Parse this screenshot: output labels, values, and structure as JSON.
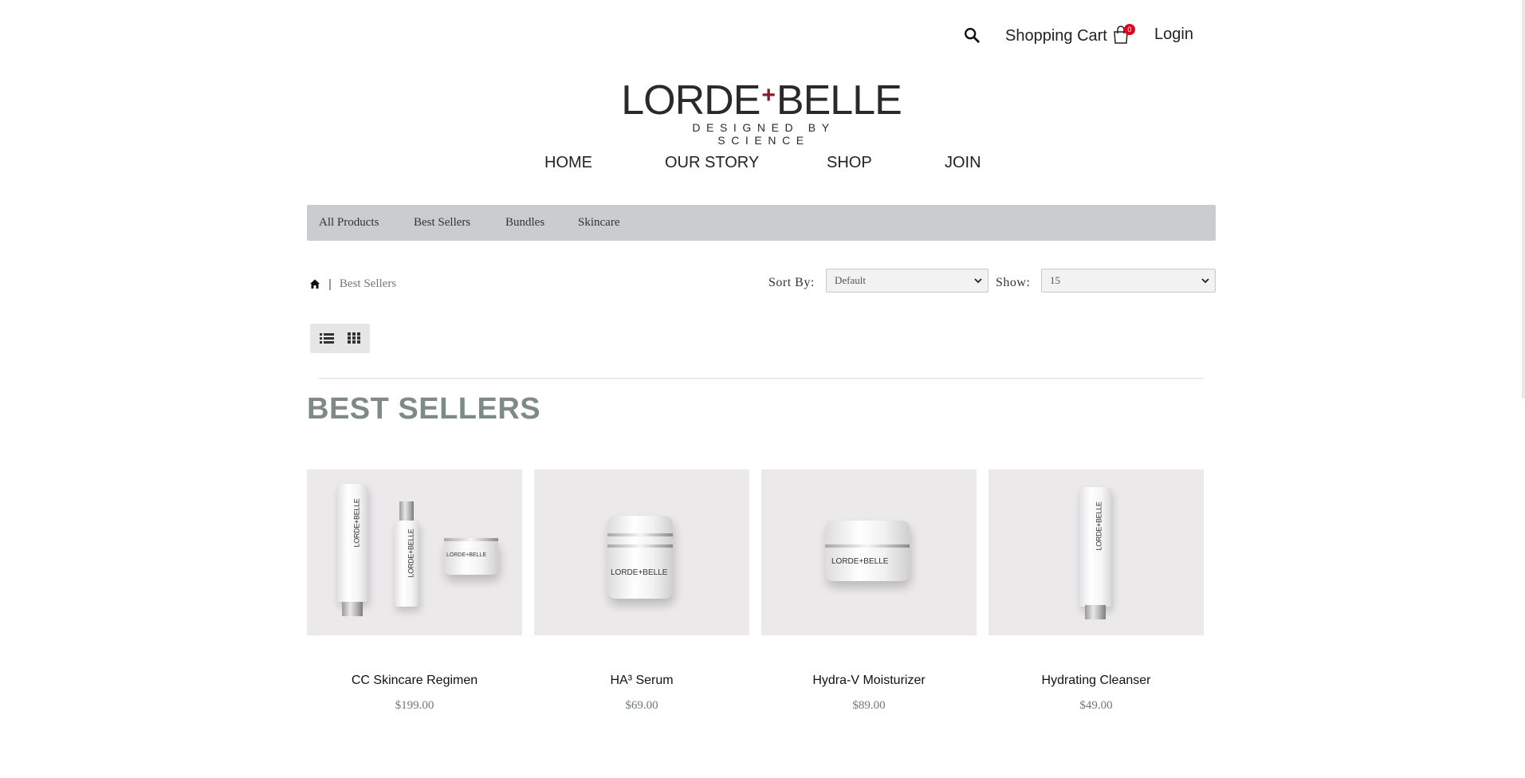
{
  "topbar": {
    "cart_label": "Shopping Cart",
    "cart_count": "0",
    "login_label": "Login"
  },
  "logo": {
    "brand_left": "LORDE",
    "brand_plus": "+",
    "brand_right": "BELLE",
    "tagline": "DESIGNED BY SCIENCE"
  },
  "mainnav": {
    "items": [
      "HOME",
      "OUR STORY",
      "SHOP",
      "JOIN"
    ]
  },
  "categories": {
    "items": [
      "All Products",
      "Best Sellers",
      "Bundles",
      "Skincare"
    ]
  },
  "breadcrumb": {
    "current": "Best Sellers",
    "separator": "|"
  },
  "controls": {
    "sort_label": "Sort By:",
    "sort_value": "Default",
    "show_label": "Show:",
    "show_value": "15"
  },
  "page": {
    "title": "BEST SELLERS"
  },
  "products": [
    {
      "name": "CC Skincare Regimen",
      "price": "$199.00"
    },
    {
      "name": "HA³ Serum",
      "price": "$69.00"
    },
    {
      "name": "Hydra-V Moisturizer",
      "price": "$89.00"
    },
    {
      "name": "Hydrating Cleanser",
      "price": "$49.00"
    }
  ],
  "colors": {
    "badge": "#e0001b",
    "category_bar": "#cbcccd",
    "title": "#7e8a86",
    "brand_plus": "#8a1c2b"
  }
}
